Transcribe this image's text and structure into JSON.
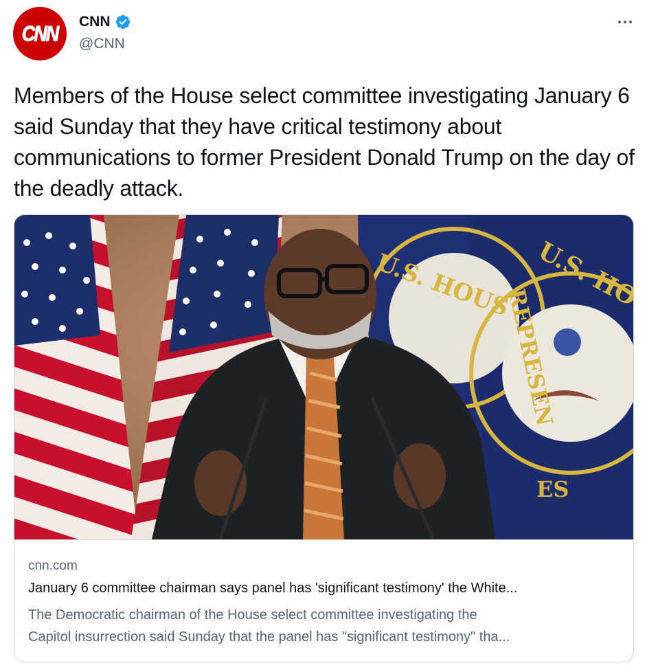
{
  "account": {
    "display_name": "CNN",
    "handle": "@CNN",
    "avatar_text": "CNN",
    "verified": true
  },
  "tweet": {
    "text": "Members of the House select committee investigating January 6 said Sunday that they have critical testimony about communications to former President Donald Trump on the day of the deadly attack."
  },
  "card": {
    "domain": "cnn.com",
    "title": "January 6 committee chairman says panel has 'significant testimony' the White...",
    "description_line1": "The Democratic chairman of the House select committee investigating the",
    "description_line2": "Capitol insurrection said Sunday that the panel has \"significant testimony\" tha...",
    "image_seal_text_left": "U.S. HOUS",
    "image_seal_text_right": "U.S. HOUSE OF",
    "image_seal_text_represent": "REPRESEN",
    "image_seal_text_es": "ES"
  },
  "colors": {
    "brand_red": "#cc0000",
    "verified_blue": "#1d9bf0",
    "text_primary": "#0f1419",
    "text_secondary": "#536471",
    "border": "#cfd9de"
  },
  "icons": {
    "verified": "verified-badge-icon",
    "more": "more-options-icon"
  }
}
